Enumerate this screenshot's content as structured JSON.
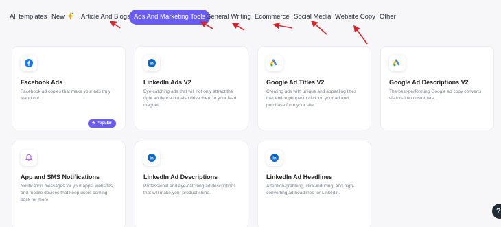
{
  "tabs": [
    {
      "label": "All templates"
    },
    {
      "label": "New"
    },
    {
      "label": "Article And Blogs"
    },
    {
      "label": "Ads And Marketing Tools",
      "active": true
    },
    {
      "label": "General Writing"
    },
    {
      "label": "Ecommerce"
    },
    {
      "label": "Social Media"
    },
    {
      "label": "Website Copy"
    },
    {
      "label": "Other"
    }
  ],
  "cards": [
    {
      "title": "Facebook Ads",
      "desc": "Facebook ad copies that make your ads truly stand out.",
      "icon": "facebook-icon",
      "badge": "★ Popular"
    },
    {
      "title": "LinkedIn Ads V2",
      "desc": "Eye-catching ads that will not only attract the right audience but also drive them to your lead magnet.",
      "icon": "linkedin-icon"
    },
    {
      "title": "Google Ad Titles V2",
      "desc": "Creating ads with unique and appealing titles that entice people to click on your ad and purchase from your site.",
      "icon": "google-ads-icon"
    },
    {
      "title": "Google Ad Descriptions V2",
      "desc": "The best-performing Google ad copy converts visitors into customers...",
      "icon": "google-ads-icon"
    },
    {
      "title": "App and SMS Notifications",
      "desc": "Notification messages for your apps, websites, and mobile devices that keep users coming back for more.",
      "icon": "bell-icon"
    },
    {
      "title": "LinkedIn Ad Descriptions",
      "desc": "Professional and eye-catching ad descriptions that will make your product shine.",
      "icon": "linkedin-icon"
    },
    {
      "title": "LinkedIn Ad Headlines",
      "desc": "Attention-grabbing, click-inducing, and high-converting ad headlines for Linkedin.",
      "icon": "linkedin-icon"
    }
  ],
  "help": {
    "label": "?"
  },
  "colors": {
    "accent": "#6b5cf0",
    "annotation_arrow": "#d9262e",
    "linkedin": "#0a66c2",
    "facebook": "#1877f2"
  }
}
